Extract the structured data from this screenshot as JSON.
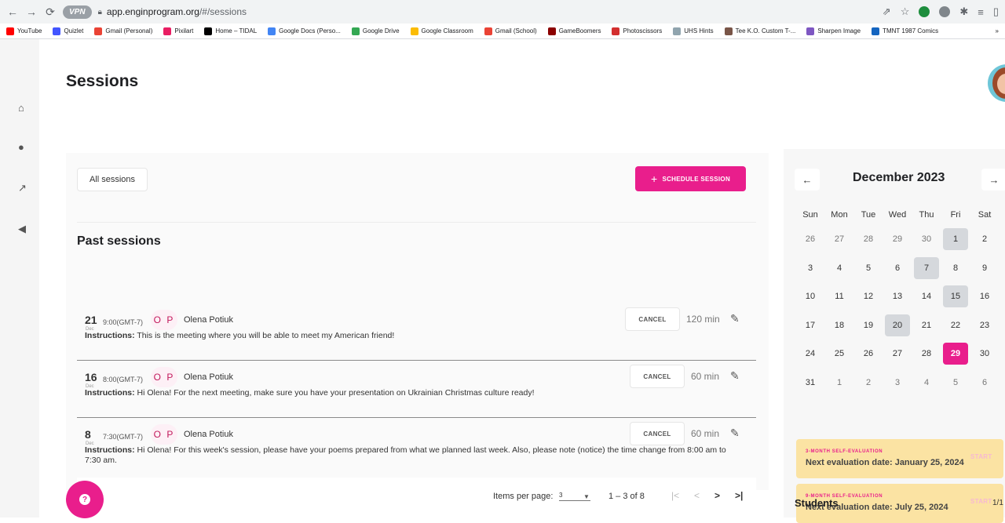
{
  "browser": {
    "vpn_label": "VPN",
    "url_host": "app.enginprogram.org",
    "url_path": "/#/sessions",
    "bookmarks": [
      {
        "label": "YouTube",
        "color": "#ff0000"
      },
      {
        "label": "Quizlet",
        "color": "#4255ff"
      },
      {
        "label": "Gmail (Personal)",
        "color": "#ea4335"
      },
      {
        "label": "Pixilart",
        "color": "#e91e63"
      },
      {
        "label": "Home – TIDAL",
        "color": "#000000"
      },
      {
        "label": "Google Docs (Perso...",
        "color": "#4285f4"
      },
      {
        "label": "Google Drive",
        "color": "#34a853"
      },
      {
        "label": "Google Classroom",
        "color": "#fbbc04"
      },
      {
        "label": "Gmail (School)",
        "color": "#ea4335"
      },
      {
        "label": "GameBoomers",
        "color": "#8b0000"
      },
      {
        "label": "Photoscissors",
        "color": "#d32f2f"
      },
      {
        "label": "UHS Hints",
        "color": "#90a4ae"
      },
      {
        "label": "Tee K.O. Custom T-...",
        "color": "#795548"
      },
      {
        "label": "Sharpen Image",
        "color": "#7e57c2"
      },
      {
        "label": "TMNT 1987 Comics",
        "color": "#1565c0"
      }
    ],
    "bookmarks_more": "»"
  },
  "page": {
    "title": "Sessions"
  },
  "toolbar": {
    "filter_label": "All sessions",
    "schedule_label": "SCHEDULE SESSION",
    "schedule_icon": "+"
  },
  "past": {
    "title": "Past sessions",
    "instructions_label": "Instructions:",
    "sessions": [
      {
        "day": "21",
        "month": "Dec",
        "time": "9:00(GMT-7)",
        "initials": "O P",
        "name": "Olena Potiuk",
        "cancel": "CANCEL",
        "duration": "120 min",
        "instructions": "This is the meeting where you will be able to meet my American friend!"
      },
      {
        "day": "16",
        "month": "Dec",
        "time": "8:00(GMT-7)",
        "initials": "O P",
        "name": "Olena Potiuk",
        "cancel": "CANCEL",
        "duration": "60 min",
        "instructions": "Hi Olena! For the next meeting, make sure you have your presentation on Ukrainian Christmas culture ready!"
      },
      {
        "day": "8",
        "month": "Dec",
        "time": "7:30(GMT-7)",
        "initials": "O P",
        "name": "Olena Potiuk",
        "cancel": "CANCEL",
        "duration": "60 min",
        "instructions": "Hi Olena! For this week's session, please have your poems prepared from what we planned last week. Also, please note (notice) the time change from 8:00 am to 7:30 am."
      }
    ]
  },
  "pager": {
    "items_label": "Items per page:",
    "items_value": "3",
    "range": "1 – 3 of 8"
  },
  "calendar": {
    "month_label": "December 2023",
    "weekdays": [
      "Sun",
      "Mon",
      "Tue",
      "Wed",
      "Thu",
      "Fri",
      "Sat"
    ],
    "weeks": [
      [
        "26",
        "27",
        "28",
        "29",
        "30",
        "1",
        "2"
      ],
      [
        "3",
        "4",
        "5",
        "6",
        "7",
        "8",
        "9"
      ],
      [
        "10",
        "11",
        "12",
        "13",
        "14",
        "15",
        "16"
      ],
      [
        "17",
        "18",
        "19",
        "20",
        "21",
        "22",
        "23"
      ],
      [
        "24",
        "25",
        "26",
        "27",
        "28",
        "29",
        "30"
      ],
      [
        "31",
        "1",
        "2",
        "3",
        "4",
        "5",
        "6"
      ]
    ],
    "highlighted": [
      "1",
      "7",
      "15",
      "20"
    ],
    "today": "29"
  },
  "evaluations": [
    {
      "tag": "3-MONTH SELF-EVALUATION",
      "text": "Next evaluation date: January 25, 2024",
      "action": "START"
    },
    {
      "tag": "9-MONTH SELF-EVALUATION",
      "text": "Next evaluation date: July 25, 2024",
      "action": "START"
    }
  ],
  "students": {
    "title": "Students",
    "count": "1/1"
  },
  "colors": {
    "accent": "#e91e8c",
    "eval_bg": "#fbe3a3"
  }
}
